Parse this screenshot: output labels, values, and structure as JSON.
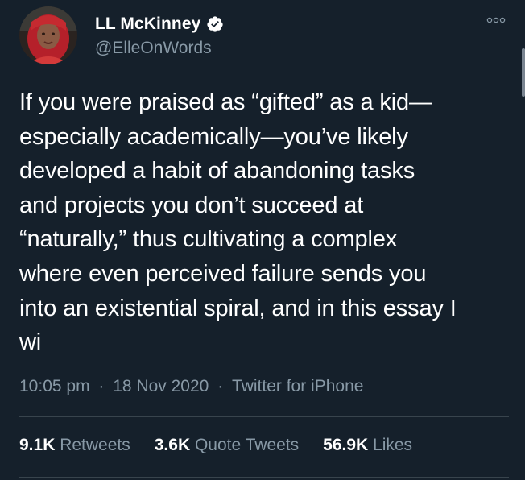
{
  "user": {
    "display_name": "LL McKinney",
    "handle": "@ElleOnWords",
    "verified": true,
    "avatar_icon": "profile-avatar"
  },
  "tweet": {
    "text": "If you were praised as “gifted” as a kid—\nespecially academically—you’ve likely\ndeveloped a habit of abandoning tasks\nand projects you don’t succeed at\n“naturally,” thus cultivating a complex\nwhere even perceived failure sends you\ninto an existential spiral, and in this essay I\nwi",
    "time": "10:05 pm",
    "date": "18 Nov 2020",
    "source": "Twitter for iPhone",
    "separator": "·"
  },
  "stats": {
    "retweets_count": "9.1K",
    "retweets_label": "Retweets",
    "quotes_count": "3.6K",
    "quotes_label": "Quote Tweets",
    "likes_count": "56.9K",
    "likes_label": "Likes"
  },
  "colors": {
    "background": "#15202b",
    "primary_text": "#ffffff",
    "secondary_text": "#8899a6",
    "verified_badge": "#ffffff",
    "divider": "#38444d"
  }
}
